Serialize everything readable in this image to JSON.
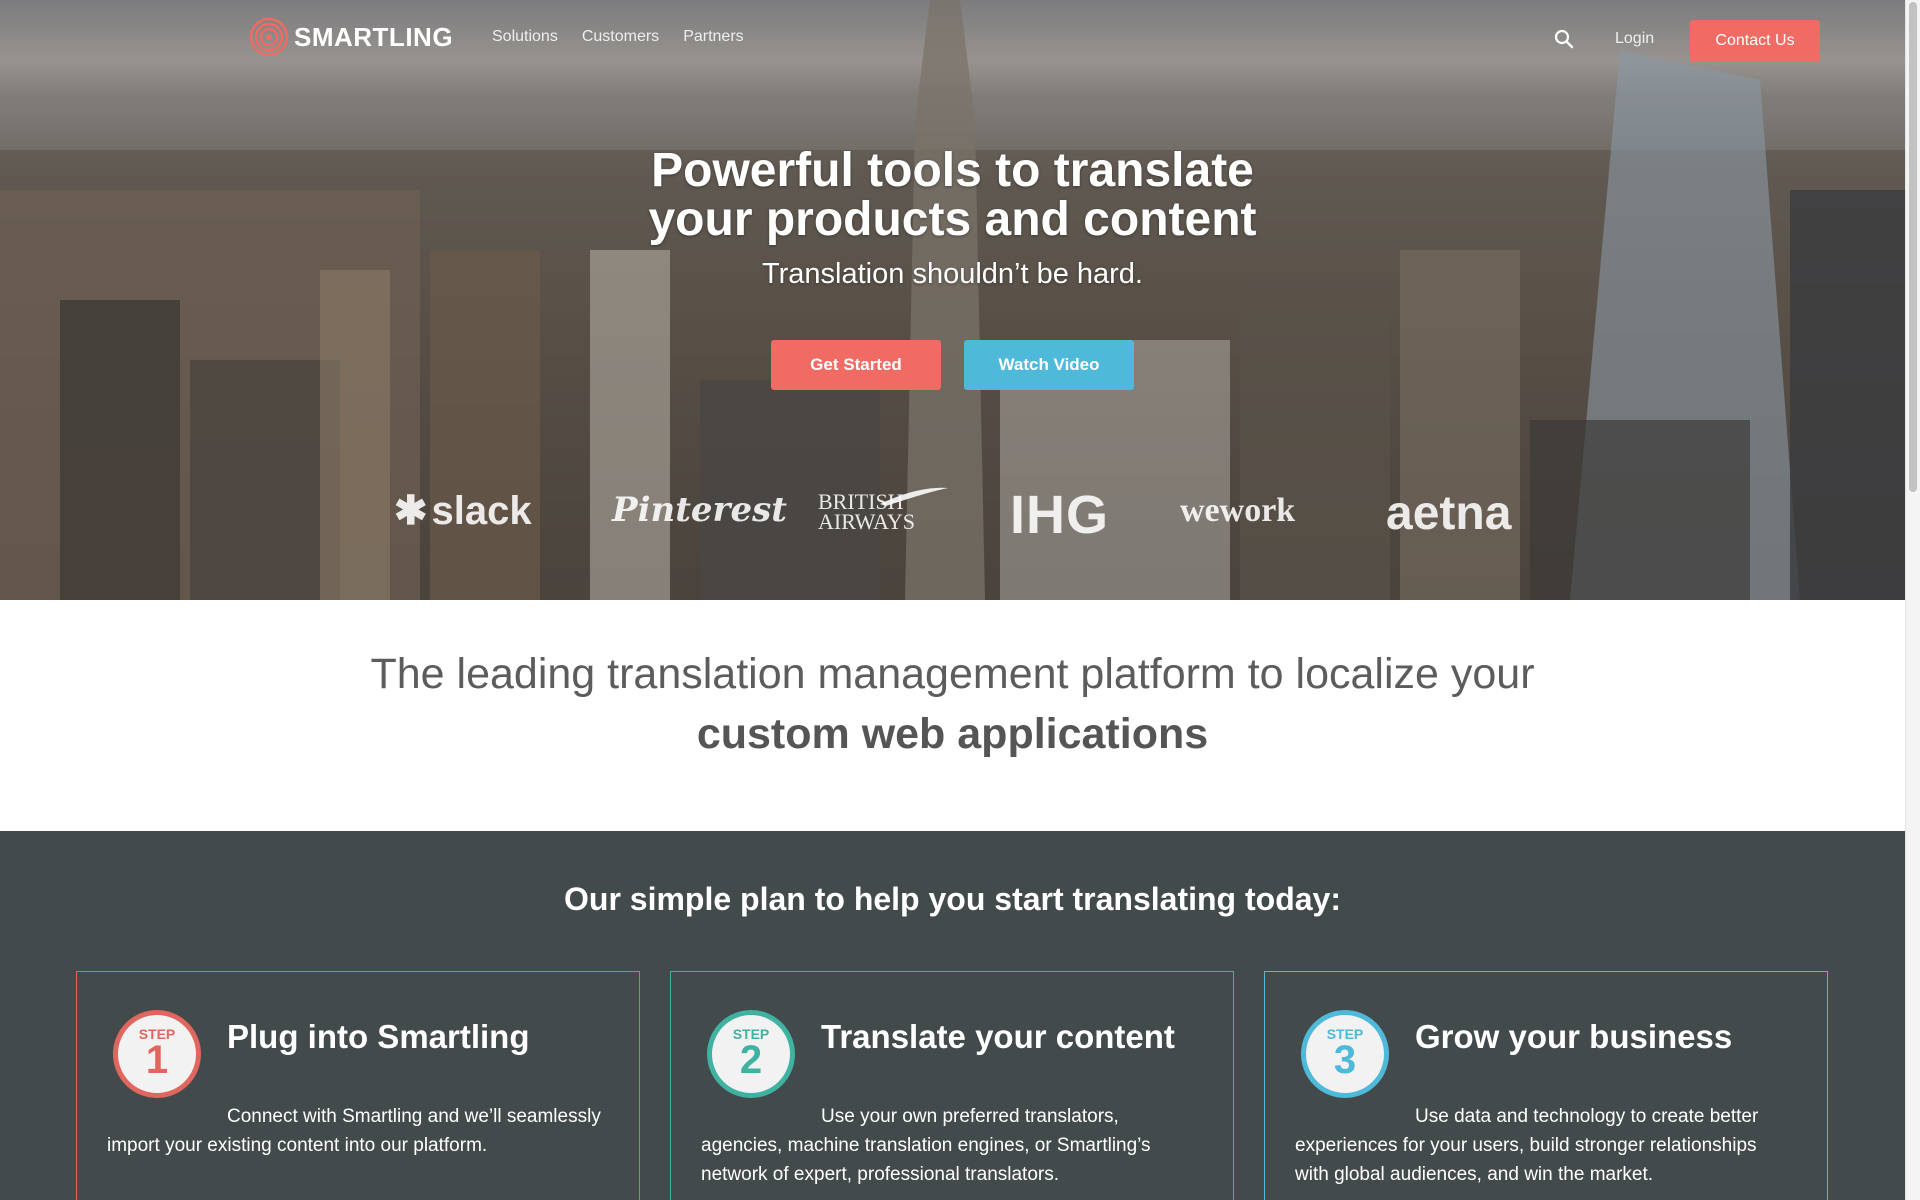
{
  "header": {
    "brand": "SMARTLING",
    "nav": [
      "Solutions",
      "Customers",
      "Partners"
    ],
    "login": "Login",
    "contact": "Contact Us"
  },
  "hero": {
    "title_line1": "Powerful tools to translate",
    "title_line2": "your products and content",
    "subtitle": "Translation shouldn’t be hard.",
    "get_started": "Get Started",
    "watch_video": "Watch Video"
  },
  "customers": {
    "slack": "slack",
    "pinterest": "Pinterest",
    "ba_line1": "BRITISH",
    "ba_line2": "AIRWAYS",
    "ihg": "IHG",
    "wework": "wework",
    "aetna": "aetna"
  },
  "tagline": {
    "line1": "The leading translation management platform to localize your",
    "line2": "custom web applications"
  },
  "plan": {
    "title": "Our simple plan to help you start translating today:",
    "steps": [
      {
        "step_label": "STEP",
        "number": "1",
        "title": "Plug into Smartling",
        "description": "Connect with Smartling and we’ll seamlessly import your existing content into our platform.",
        "color": "#e0665e"
      },
      {
        "step_label": "STEP",
        "number": "2",
        "title": "Translate your content",
        "description": "Use your own preferred translators, agencies, machine translation engines, or Smartling’s network of expert, professional translators.",
        "color": "#3fb2a2"
      },
      {
        "step_label": "STEP",
        "number": "3",
        "title": "Grow your business",
        "description": "Use data and technology to create better experiences for your users, build stronger relationships with global audiences, and win the market.",
        "color": "#4fb9da"
      }
    ]
  },
  "colors": {
    "accent_red": "#ef6b64",
    "accent_blue": "#4fb9da",
    "plan_bg": "#434a4c"
  }
}
